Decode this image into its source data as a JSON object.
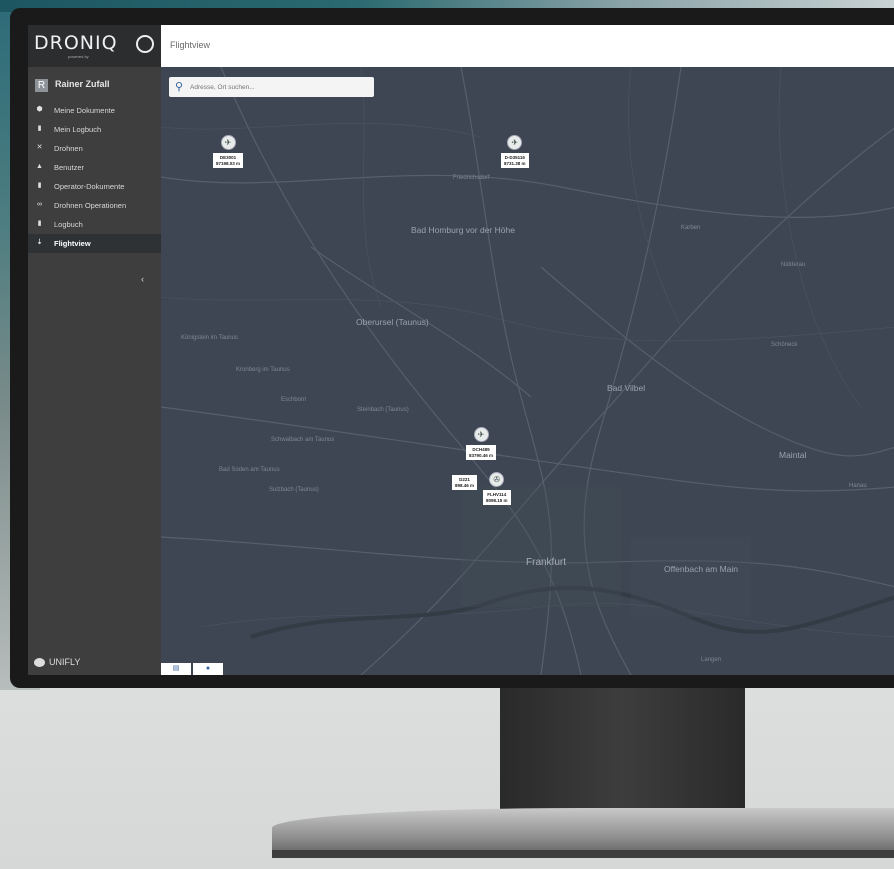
{
  "app": {
    "logo": "DRONIQ",
    "logo_powered": "powered by",
    "footer_brand": "UNIFLY"
  },
  "user": {
    "initial": "R",
    "name": "Rainer Zufall"
  },
  "sidebar": {
    "items": [
      {
        "label": "Meine Dokumente",
        "icon": "shield-icon",
        "glyph": "⬢"
      },
      {
        "label": "Mein Logbuch",
        "icon": "book-icon",
        "glyph": "▮"
      },
      {
        "label": "Drohnen",
        "icon": "drone-icon",
        "glyph": "✕"
      },
      {
        "label": "Benutzer",
        "icon": "user-icon",
        "glyph": "▲"
      },
      {
        "label": "Operator-Dokumente",
        "icon": "document-icon",
        "glyph": "▮"
      },
      {
        "label": "Drohnen Operationen",
        "icon": "operations-icon",
        "glyph": "∞"
      },
      {
        "label": "Logbuch",
        "icon": "logbook-icon",
        "glyph": "▮"
      },
      {
        "label": "Flightview",
        "icon": "flightview-icon",
        "glyph": "⇣"
      }
    ],
    "collapse_glyph": "‹"
  },
  "header": {
    "title": "Flightview"
  },
  "search": {
    "placeholder": "Adresse, Ort suchen..."
  },
  "map": {
    "places": [
      {
        "name": "Bad Homburg vor der Höhe",
        "size": "big"
      },
      {
        "name": "Oberursel (Taunus)",
        "size": "big"
      },
      {
        "name": "Bad Vilbel",
        "size": "big"
      },
      {
        "name": "Frankfurt",
        "size": "xl"
      },
      {
        "name": "Offenbach am Main",
        "size": "big"
      },
      {
        "name": "Maintal",
        "size": "big"
      },
      {
        "name": "Friedrichsdorf",
        "size": "small"
      },
      {
        "name": "Karben",
        "size": "small"
      },
      {
        "name": "Schöneck",
        "size": "small"
      },
      {
        "name": "Eschborn",
        "size": "small"
      },
      {
        "name": "Kronberg im Taunus",
        "size": "small"
      },
      {
        "name": "Schwalbach am Taunus",
        "size": "small"
      },
      {
        "name": "Bad Soden am Taunus",
        "size": "small"
      },
      {
        "name": "Sulzbach (Taunus)",
        "size": "small"
      },
      {
        "name": "Steinbach (Taunus)",
        "size": "small"
      },
      {
        "name": "Königstein im Taunus",
        "size": "small"
      },
      {
        "name": "Nidderau",
        "size": "small"
      },
      {
        "name": "Hanau",
        "size": "small"
      },
      {
        "name": "Langen",
        "size": "small"
      }
    ],
    "drones": [
      {
        "id": "DE3001",
        "reading": "87198.03 m"
      },
      {
        "id": "D-D35116",
        "reading": "8731.38 m"
      },
      {
        "id": "DCH489",
        "reading": "83790.46 m"
      },
      {
        "id": "D221",
        "reading": "898.46 m"
      },
      {
        "id": "FLHV114",
        "reading": "8098.15 m"
      }
    ],
    "buttons": [
      {
        "label": "▤",
        "icon": "layers-icon"
      },
      {
        "label": "●",
        "icon": "locate-icon"
      }
    ]
  },
  "colors": {
    "sidebar": "#3e3e3e",
    "map": "#3d4652",
    "accent": "#345f9c"
  }
}
